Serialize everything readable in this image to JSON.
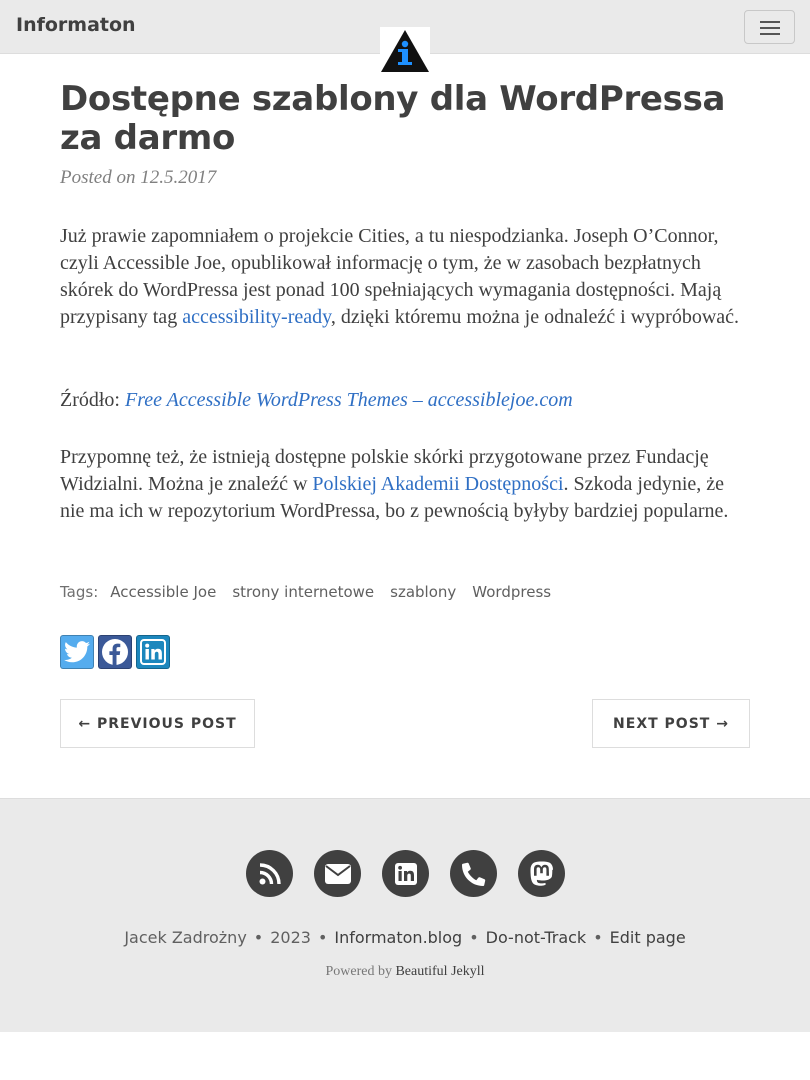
{
  "navbar": {
    "brand": "Informaton",
    "logo_icon": "info-triangle-icon",
    "menu_icon": "hamburger-icon"
  },
  "post": {
    "title": "Dostępne szablony dla WordPressa za darmo",
    "meta": "Posted on 12.5.2017",
    "p1_a": "Już prawie zapomniałem o projekcie Cities, a tu niespodzianka. Joseph O’Connor, czyli Accessible Joe, opublikował informację o tym, że w zasobach bezpłatnych skórek do WordPressa jest ponad 100 spełniających wymagania dostępności. Mają przypisany tag ",
    "p1_link": "accessibility-ready",
    "p1_b": ", dzięki któremu można je odnaleźć i wypróbować.",
    "source_label": "Źródło: ",
    "source_link": "Free Accessible WordPress Themes – accessiblejoe.com",
    "p2_a": "Przypomnę też, że istnieją dostępne polskie skórki przygotowane przez Fundację Widzialni. Można je znaleźć w ",
    "p2_link": "Polskiej Akademii Dostępności",
    "p2_b": ". Szkoda jedynie, że nie ma ich w repozytorium WordPressa, bo z pewnością byłyby bardziej popularne."
  },
  "tags": {
    "label": "Tags:",
    "items": [
      "Accessible Joe",
      "strony internetowe",
      "szablony",
      "Wordpress"
    ]
  },
  "share": [
    "twitter-icon",
    "facebook-icon",
    "linkedin-icon"
  ],
  "pager": {
    "prev": "← PREVIOUS POST",
    "next": "NEXT POST →"
  },
  "footer": {
    "social": [
      "rss-icon",
      "envelope-icon",
      "linkedin-icon",
      "phone-icon",
      "mastodon-icon"
    ],
    "author": "Jacek Zadrożny",
    "year": "2023",
    "site": "Informaton.blog",
    "dnt": "Do-not-Track",
    "edit": "Edit page",
    "powered_by": "Powered by",
    "powered_link": "Beautiful Jekyll"
  },
  "colors": {
    "navbar_bg": "#eaeaea",
    "text": "#404040",
    "link": "#2f6fc4",
    "twitter": "#55acee",
    "facebook": "#3b5998",
    "linkedin": "#1c87bd",
    "logo_accent": "#1e90ff"
  }
}
